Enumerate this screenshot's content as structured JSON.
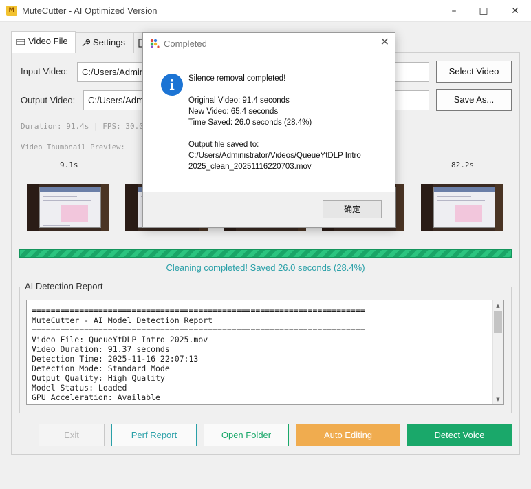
{
  "window": {
    "title": "MuteCutter - AI Optimized Version",
    "icon_text": "M"
  },
  "tabs": [
    {
      "label": "Video File",
      "icon": "video-file-icon"
    },
    {
      "label": "Settings",
      "icon": "wrench-icon"
    },
    {
      "label": "",
      "icon": "document-icon"
    }
  ],
  "form": {
    "input_label": "Input Video:",
    "input_value": "C:/Users/Administrator/Videos/QueueYtDLP Intro 2025.mov",
    "select_button": "Select Video",
    "output_label": "Output Video:",
    "output_value": "C:/Users/Administrator/Videos/QueueYtDLP Intro 2025_clean_20251116220703.mov",
    "save_button": "Save As..."
  },
  "video_info": "Duration: 91.4s | FPS: 30.0 |",
  "thumbnail_label": "Video Thumbnail Preview:",
  "thumbnails": [
    {
      "time": "9.1s"
    },
    {
      "time": ""
    },
    {
      "time": ""
    },
    {
      "time": ""
    },
    {
      "time": "82.2s"
    }
  ],
  "progress": {
    "fraction": 1.0
  },
  "status_text": "Cleaning completed! Saved 26.0 seconds (28.4%)",
  "report": {
    "title": "AI Detection Report",
    "lines": [
      "======================================================================",
      "MuteCutter - AI Model Detection Report",
      "======================================================================",
      "Video File: QueueYtDLP Intro 2025.mov",
      "Video Duration: 91.37 seconds",
      "Detection Time: 2025-11-16 22:07:13",
      "Detection Mode: Standard Mode",
      "Output Quality: High Quality",
      "Model Status: Loaded",
      "GPU Acceleration: Available"
    ]
  },
  "buttons": {
    "exit": "Exit",
    "perf_report": "Perf Report",
    "open_folder": "Open Folder",
    "auto_editing": "Auto Editing",
    "detect_voice": "Detect Voice"
  },
  "dialog": {
    "title": "Completed",
    "heading": "Silence removal completed!",
    "original": "Original Video: 91.4 seconds",
    "new": "New Video: 65.4 seconds",
    "saved": "Time Saved: 26.0 seconds (28.4%)",
    "output_label": "Output file saved to:",
    "output_path_1": "C:/Users/Administrator/Videos/QueueYtDLP Intro",
    "output_path_2": "2025_clean_20251116220703.mov",
    "ok_button": "确定"
  },
  "colors": {
    "accent_teal": "#2aa0a8",
    "progress_green": "#1db574",
    "auto_editing_orange": "#f0ac4f",
    "detect_voice_green": "#1aa86a",
    "info_blue": "#1c74d4"
  }
}
